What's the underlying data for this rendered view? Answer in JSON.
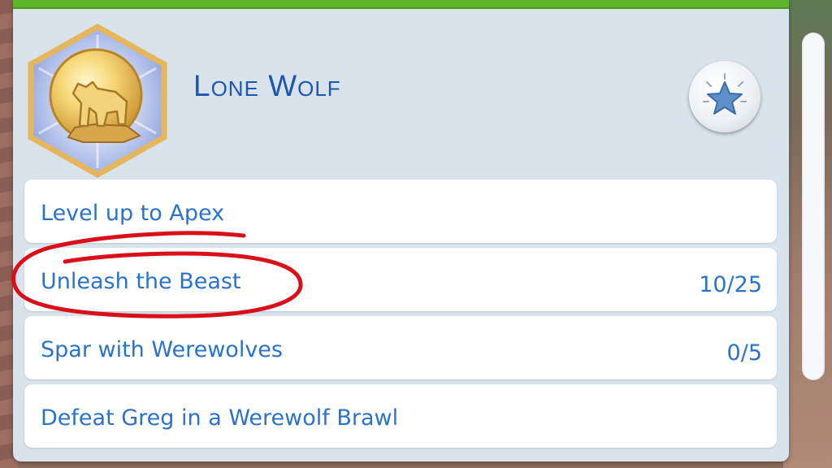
{
  "aspiration": {
    "title": "Lone Wolf",
    "badge_icon": "wolf-on-rock-icon",
    "favorite_icon": "star-icon"
  },
  "milestones": [
    {
      "label": "Level up to Apex",
      "progress": ""
    },
    {
      "label": "Unleash the Beast",
      "progress": "10/25"
    },
    {
      "label": "Spar with Werewolves",
      "progress": "0/5"
    },
    {
      "label": "Defeat Greg in a Werewolf Brawl",
      "progress": ""
    }
  ],
  "colors": {
    "text_blue": "#2a73c9",
    "title_blue": "#1e56b0",
    "panel_bg": "#d9e3ec",
    "top_bar_green": "#5fb32d",
    "annotation_red": "#d9101a"
  }
}
